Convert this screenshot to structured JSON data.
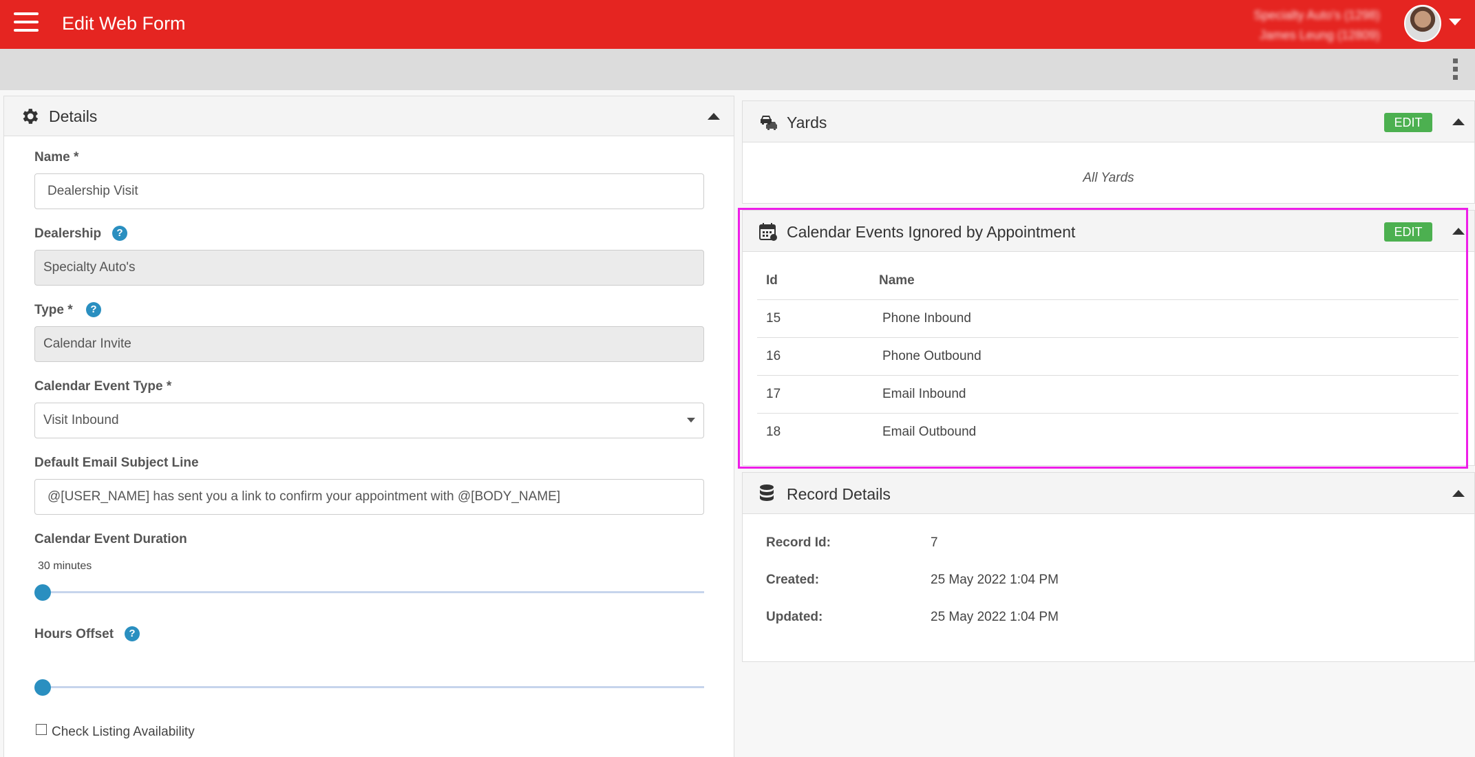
{
  "header": {
    "title": "Edit Web Form",
    "user_line1": "Specialty Auto's (1298)",
    "user_line2": "James Leung (12809)"
  },
  "colors": {
    "brand": "#e52521",
    "accent": "#2a8fc0",
    "edit_button": "#4cb050",
    "highlight": "#ee1ee8"
  },
  "details": {
    "title": "Details",
    "name": {
      "label": "Name *",
      "value": "Dealership Visit"
    },
    "dealership": {
      "label": "Dealership",
      "value": "Specialty Auto's"
    },
    "type": {
      "label": "Type *",
      "value": "Calendar Invite"
    },
    "calendar_event_type": {
      "label": "Calendar Event Type *",
      "value": "Visit Inbound"
    },
    "email_subject": {
      "label": "Default Email Subject Line",
      "value": "@[USER_NAME] has sent you a link to confirm your appointment with @[BODY_NAME]"
    },
    "duration": {
      "label": "Calendar Event Duration",
      "value_text": "30 minutes",
      "slider_fraction": 0
    },
    "hours_offset": {
      "label": "Hours Offset",
      "slider_fraction": 0
    },
    "check_listing": {
      "label": "Check Listing Availability",
      "checked": false
    }
  },
  "yards": {
    "title": "Yards",
    "edit_label": "EDIT",
    "summary": "All Yards"
  },
  "calendar_events": {
    "title": "Calendar Events Ignored by Appointment",
    "edit_label": "EDIT",
    "columns": [
      "Id",
      "Name"
    ],
    "rows": [
      {
        "id": "15",
        "name": "Phone Inbound"
      },
      {
        "id": "16",
        "name": "Phone Outbound"
      },
      {
        "id": "17",
        "name": "Email Inbound"
      },
      {
        "id": "18",
        "name": "Email Outbound"
      }
    ]
  },
  "record_details": {
    "title": "Record Details",
    "record_id_label": "Record Id:",
    "record_id": "7",
    "created_label": "Created:",
    "created": "25 May 2022 1:04 PM",
    "updated_label": "Updated:",
    "updated": "25 May 2022 1:04 PM"
  },
  "icons": {
    "menu": "hamburger-icon",
    "more": "kebab-icon",
    "details": "gear-icon",
    "yards": "cars-icon",
    "calendar": "calendar-icon",
    "record": "database-icon"
  }
}
